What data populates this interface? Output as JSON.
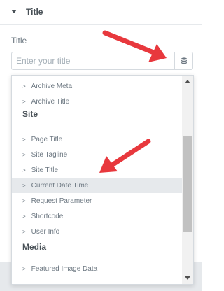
{
  "section": {
    "title": "Title"
  },
  "field": {
    "label": "Title",
    "placeholder": "Enter your title"
  },
  "dynamic_tags": {
    "items": [
      {
        "type": "item",
        "label": "Archive Meta"
      },
      {
        "type": "item",
        "label": "Archive Title"
      },
      {
        "type": "group",
        "label": "Site"
      },
      {
        "type": "item",
        "label": "Page Title"
      },
      {
        "type": "item",
        "label": "Site Tagline"
      },
      {
        "type": "item",
        "label": "Site Title"
      },
      {
        "type": "item",
        "label": "Current Date Time",
        "active": true
      },
      {
        "type": "item",
        "label": "Request Parameter"
      },
      {
        "type": "item",
        "label": "Shortcode"
      },
      {
        "type": "item",
        "label": "User Info"
      },
      {
        "type": "group",
        "label": "Media"
      },
      {
        "type": "item",
        "label": "Featured Image Data"
      }
    ],
    "item_bullet": ">"
  },
  "colors": {
    "annotation_arrow": "#e8383d",
    "active_row": "#e6e9ec"
  },
  "icons": {
    "dynamic_button": "database-icon",
    "collapse": "caret-down-icon"
  }
}
